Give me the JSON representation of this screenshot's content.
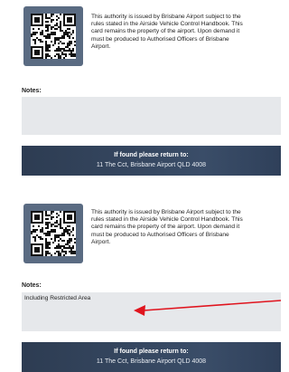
{
  "cards": [
    {
      "authority_text": "This authority is issued by Brisbane Airport subject to the\nrules stated in the Airside Vehicle Control Handbook. This\ncard remains the property of the airport. Upon demand it\nmust be produced to Authorised Officers of Brisbane\nAirport.",
      "notes_label": "Notes:",
      "notes_value": "",
      "return_title": "If found please return to:",
      "return_address": "11 The Cct, Brisbane Airport QLD 4008"
    },
    {
      "authority_text": "This authority is issued by Brisbane Airport subject to the\nrules stated in the Airside Vehicle Control Handbook. This\ncard remains the property of the airport. Upon demand it\nmust be produced to Authorised Officers of Brisbane\nAirport.",
      "notes_label": "Notes:",
      "notes_value": "Including Restricted Area",
      "return_title": "If found please return to:",
      "return_address": "11 The Cct, Brisbane Airport QLD 4008"
    }
  ],
  "colors": {
    "banner": "#2d3c52",
    "qr_frame": "#5a6b82",
    "notes_background": "#e6e8eb",
    "arrow": "#e0141e"
  },
  "icons": [
    "qr-code-icon",
    "arrow-icon"
  ]
}
